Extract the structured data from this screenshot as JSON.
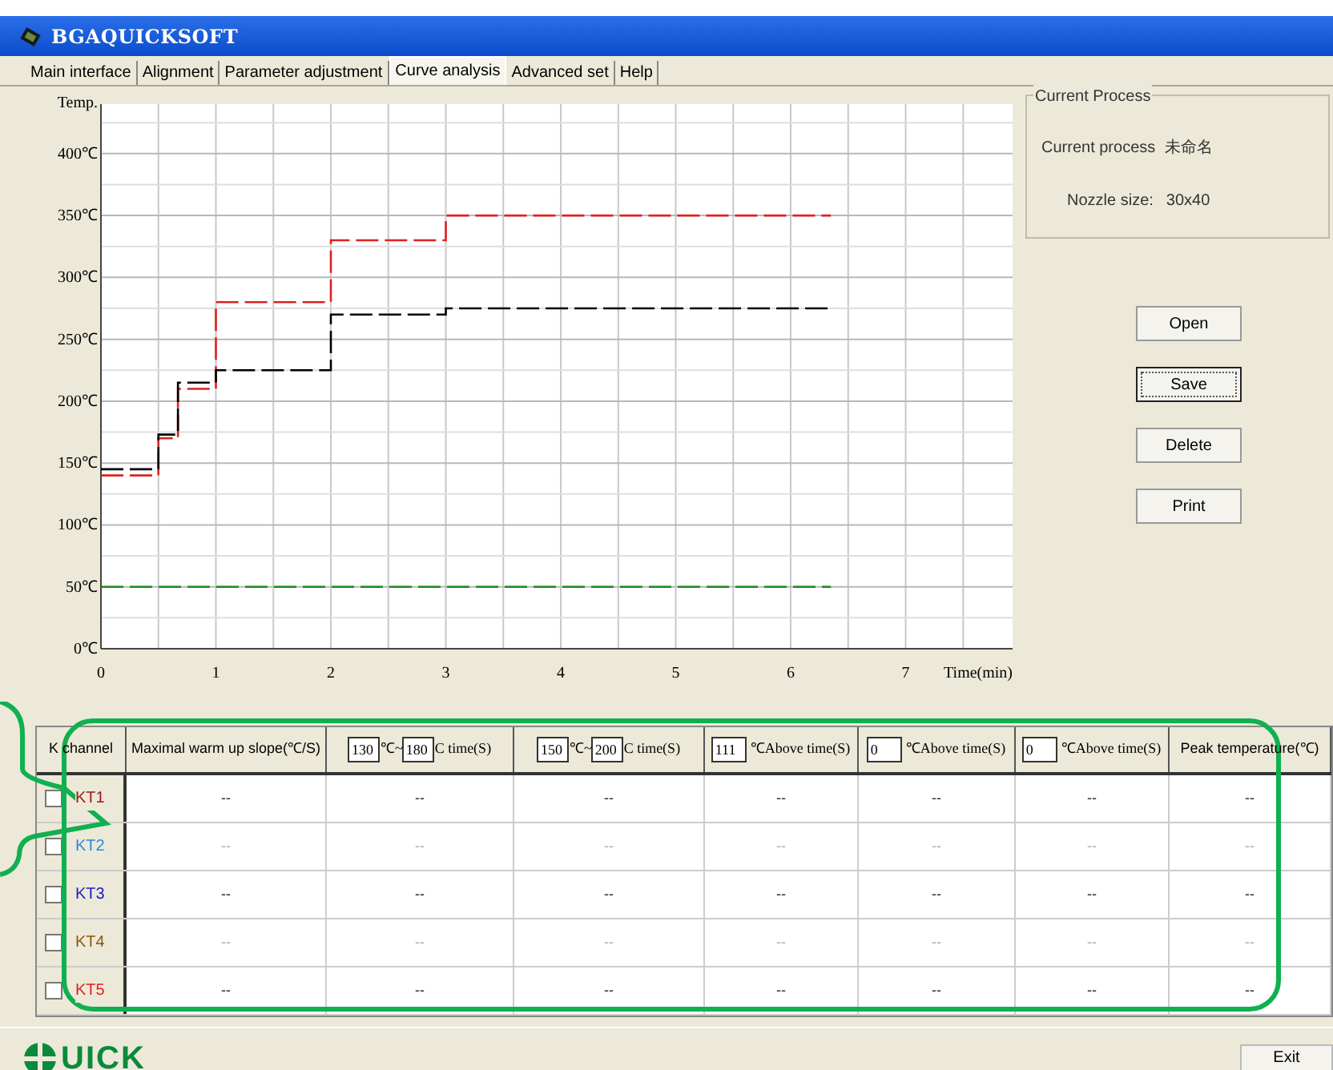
{
  "window": {
    "title": "BGAQUICKSOFT"
  },
  "tabs": [
    {
      "label": "Main interface",
      "selected": false
    },
    {
      "label": "Alignment",
      "selected": false
    },
    {
      "label": "Parameter adjustment",
      "selected": false
    },
    {
      "label": "Curve analysis",
      "selected": true
    },
    {
      "label": "Advanced set",
      "selected": false
    },
    {
      "label": "Help",
      "selected": false
    }
  ],
  "chart": {
    "chart_data": {
      "type": "line",
      "grid": true,
      "ylabel": "Temp.",
      "xlabel": "Time(min)",
      "xlim": [
        0,
        7.93
      ],
      "ylim": [
        0,
        440
      ],
      "xticks": [
        0,
        1,
        2,
        3,
        4,
        5,
        6,
        7
      ],
      "yticks": [
        {
          "value": 0,
          "label": "0℃"
        },
        {
          "value": 50,
          "label": "50℃"
        },
        {
          "value": 100,
          "label": "100℃"
        },
        {
          "value": 150,
          "label": "150℃"
        },
        {
          "value": 200,
          "label": "200℃"
        },
        {
          "value": 250,
          "label": "250℃"
        },
        {
          "value": 300,
          "label": "300℃"
        },
        {
          "value": 350,
          "label": "350℃"
        },
        {
          "value": 400,
          "label": "400℃"
        }
      ],
      "x": [
        0,
        0.5,
        0.5,
        0.67,
        0.67,
        1,
        1,
        2,
        2,
        3,
        3,
        6.35
      ],
      "series": [
        {
          "color": "#e02020",
          "line_style": "dashed",
          "values": [
            140,
            140,
            170,
            170,
            210,
            210,
            280,
            280,
            330,
            330,
            350,
            350
          ]
        },
        {
          "color": "#000000",
          "line_style": "dashed",
          "values": [
            145,
            145,
            173,
            173,
            215,
            215,
            225,
            225,
            270,
            270,
            275,
            275
          ]
        },
        {
          "color": "#1a8a1a",
          "line_style": "dashed",
          "values": [
            50,
            50,
            50,
            50,
            50,
            50,
            50,
            50,
            50,
            50,
            50,
            50
          ]
        }
      ]
    }
  },
  "current_process": {
    "title": "Current Process",
    "process_label": "Current process",
    "process_value": "未命名",
    "nozzle_label": "Nozzle size:",
    "nozzle_value": "30x40"
  },
  "buttons": [
    {
      "label": "Open",
      "focused": false
    },
    {
      "label": "Save",
      "focused": true
    },
    {
      "label": "Delete",
      "focused": false
    },
    {
      "label": "Print",
      "focused": false
    }
  ],
  "table": {
    "columns": [
      {
        "kind": "text",
        "label": "K channel"
      },
      {
        "kind": "text",
        "label": "Maximal warm up slope(℃/S)"
      },
      {
        "kind": "range",
        "from": "130",
        "mid": "℃~",
        "to": "180",
        "suffix": "C time(S)"
      },
      {
        "kind": "range",
        "from": "150",
        "mid": "℃~",
        "to": "200",
        "suffix": "C time(S)"
      },
      {
        "kind": "above",
        "value": "111",
        "suffix": "℃Above time(S)"
      },
      {
        "kind": "above",
        "value": "0",
        "suffix": "℃Above time(S)"
      },
      {
        "kind": "above",
        "value": "0",
        "suffix": "℃Above time(S)"
      },
      {
        "kind": "text",
        "label": "Peak temperature(℃)"
      }
    ],
    "rows": [
      {
        "color": "#a01818",
        "checked": false,
        "cells": [
          "KT1",
          "--",
          "--",
          "--",
          "--",
          "--",
          "--",
          "--"
        ]
      },
      {
        "color": "#2a8ae0",
        "checked": false,
        "cells": [
          "KT2",
          "--",
          "--",
          "--",
          "--",
          "--",
          "--",
          "--"
        ]
      },
      {
        "color": "#1a1ad0",
        "checked": false,
        "cells": [
          "KT3",
          "--",
          "--",
          "--",
          "--",
          "--",
          "--",
          "--"
        ]
      },
      {
        "color": "#8a5a10",
        "checked": false,
        "cells": [
          "KT4",
          "--",
          "--",
          "--",
          "--",
          "--",
          "--",
          "--"
        ]
      },
      {
        "color": "#e02020",
        "checked": false,
        "cells": [
          "KT5",
          "--",
          "--",
          "--",
          "--",
          "--",
          "--",
          "--"
        ]
      }
    ]
  },
  "footer": {
    "logo_text": "UICK",
    "exit": "Exit"
  }
}
